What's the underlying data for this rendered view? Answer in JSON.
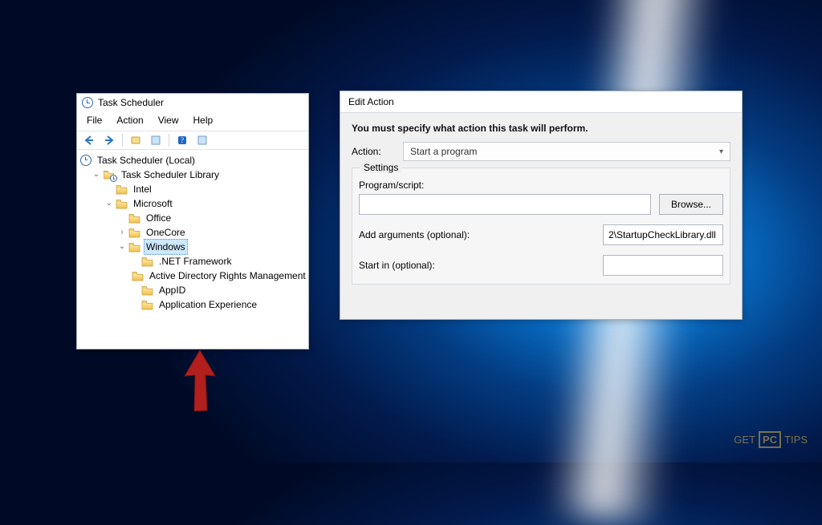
{
  "ts": {
    "title": "Task Scheduler",
    "menu": {
      "file": "File",
      "action": "Action",
      "view": "View",
      "help": "Help"
    },
    "tree": {
      "root": "Task Scheduler (Local)",
      "library": "Task Scheduler Library",
      "intel": "Intel",
      "microsoft": "Microsoft",
      "office": "Office",
      "onecore": "OneCore",
      "windows": "Windows",
      "netfx": ".NET Framework",
      "adrm": "Active Directory Rights Management",
      "appid": "AppID",
      "appexp": "Application Experience"
    }
  },
  "ea": {
    "title": "Edit Action",
    "subtitle": "You must specify what action this task will perform.",
    "action_label": "Action:",
    "action_value": "Start a program",
    "settings_label": "Settings",
    "program_label": "Program/script:",
    "program_value": "",
    "browse": "Browse...",
    "args_label": "Add arguments (optional):",
    "args_value": "2\\StartupCheckLibrary.dll",
    "startin_label": "Start in (optional):",
    "startin_value": ""
  }
}
